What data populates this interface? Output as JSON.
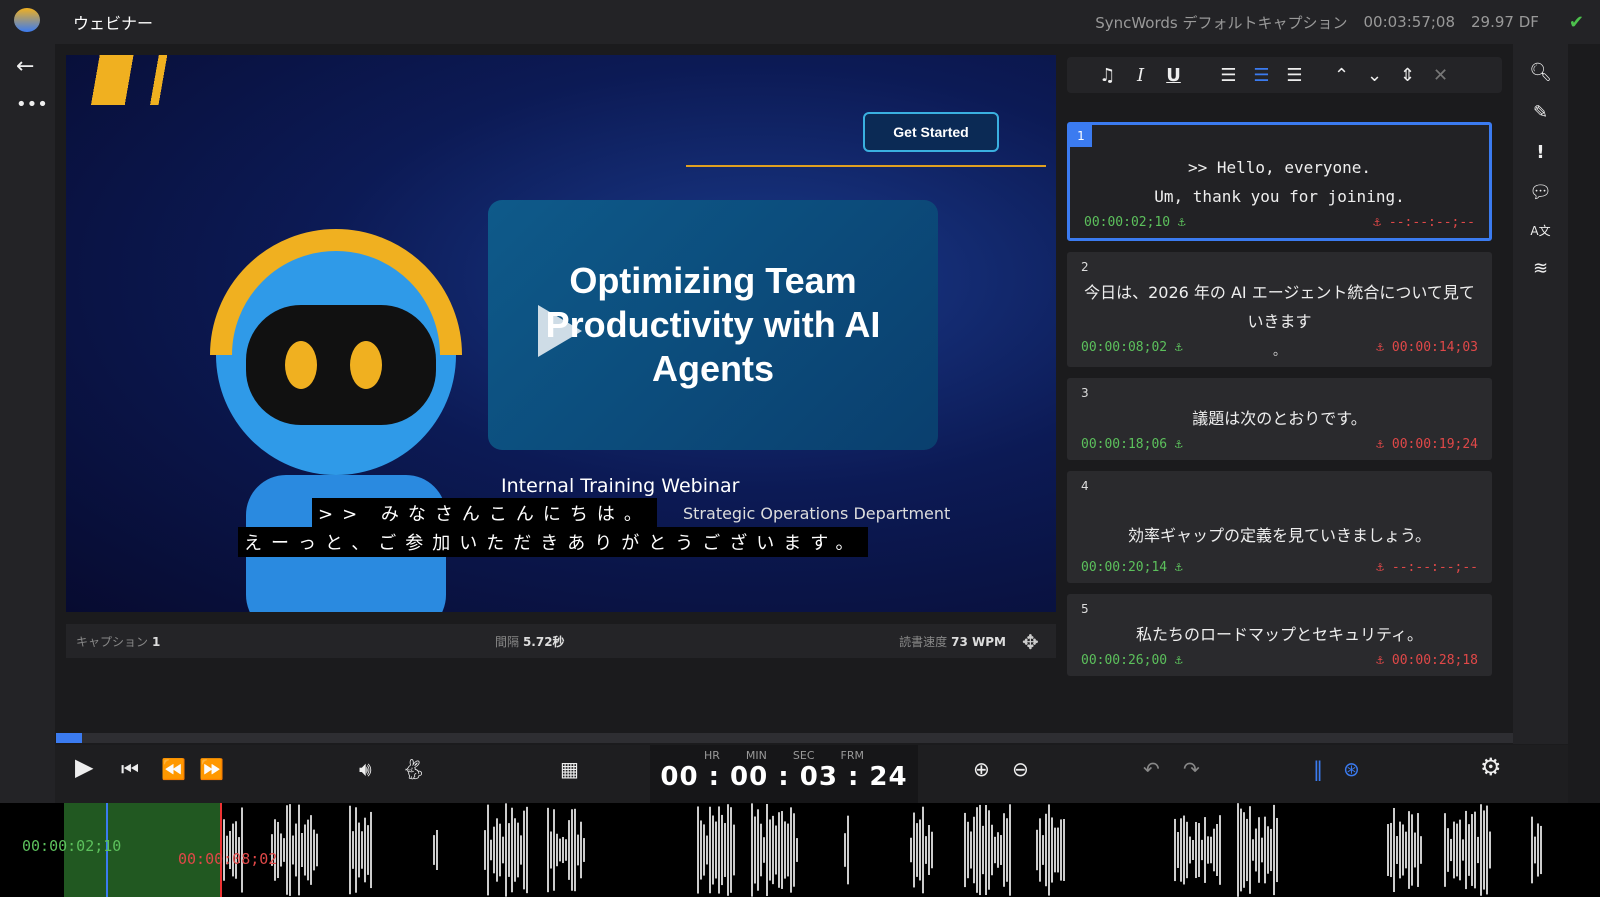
{
  "app": {
    "title": "ウェビナー",
    "caption_set": "SyncWords デフォルトキャプション",
    "duration": "00:03:57;08",
    "framerate": "29.97 DF",
    "status_icon": "check-icon"
  },
  "video": {
    "get_started": "Get Started",
    "headline": "Optimizing Team Productivity with AI Agents",
    "webinar": "Internal Training Webinar",
    "department": "Strategic Operations Department",
    "caption_line1": ">> みなさんこんにちは。",
    "caption_line2": "えーっと、ご参加いただきありがとうございます。"
  },
  "info": {
    "caption_label": "キャプション",
    "caption_value": "1",
    "gap_label": "間隔",
    "gap_value": "5.72秒",
    "speed_label": "読書速度",
    "speed_value": "73 WPM"
  },
  "captions": [
    {
      "num": "1",
      "text": ">> Hello, everyone.\nUm, thank you for joining.",
      "in": "00:00:02;10",
      "out": "--:--:--;--",
      "selected": true
    },
    {
      "num": "2",
      "text": "今日は、2026 年の AI エージェント統合について見ていきます",
      "in": "00:00:08;02",
      "out": "00:00:14;03",
      "extra": "。"
    },
    {
      "num": "3",
      "text": "議題は次のとおりです。",
      "in": "00:00:18;06",
      "out": "00:00:19;24"
    },
    {
      "num": "4",
      "text": "効率ギャップの定義を見ていきましょう。",
      "in": "00:00:20;14",
      "out": "--:--:--;--"
    },
    {
      "num": "5",
      "text": "私たちのロードマップとセキュリティ。",
      "in": "00:00:26;00",
      "out": "00:00:28;18"
    }
  ],
  "timecode": {
    "labels": [
      "HR",
      "MIN",
      "SEC",
      "FRM"
    ],
    "value": "00 : 00 : 03 : 24"
  },
  "playback": {
    "progress_percent": 1.8
  },
  "waveform": {
    "start": "00:00:02;10",
    "end": "00:00:08;02"
  },
  "colors": {
    "accent": "#3b7bf0",
    "in_time": "#5cc05c",
    "out_time": "#e04848"
  }
}
